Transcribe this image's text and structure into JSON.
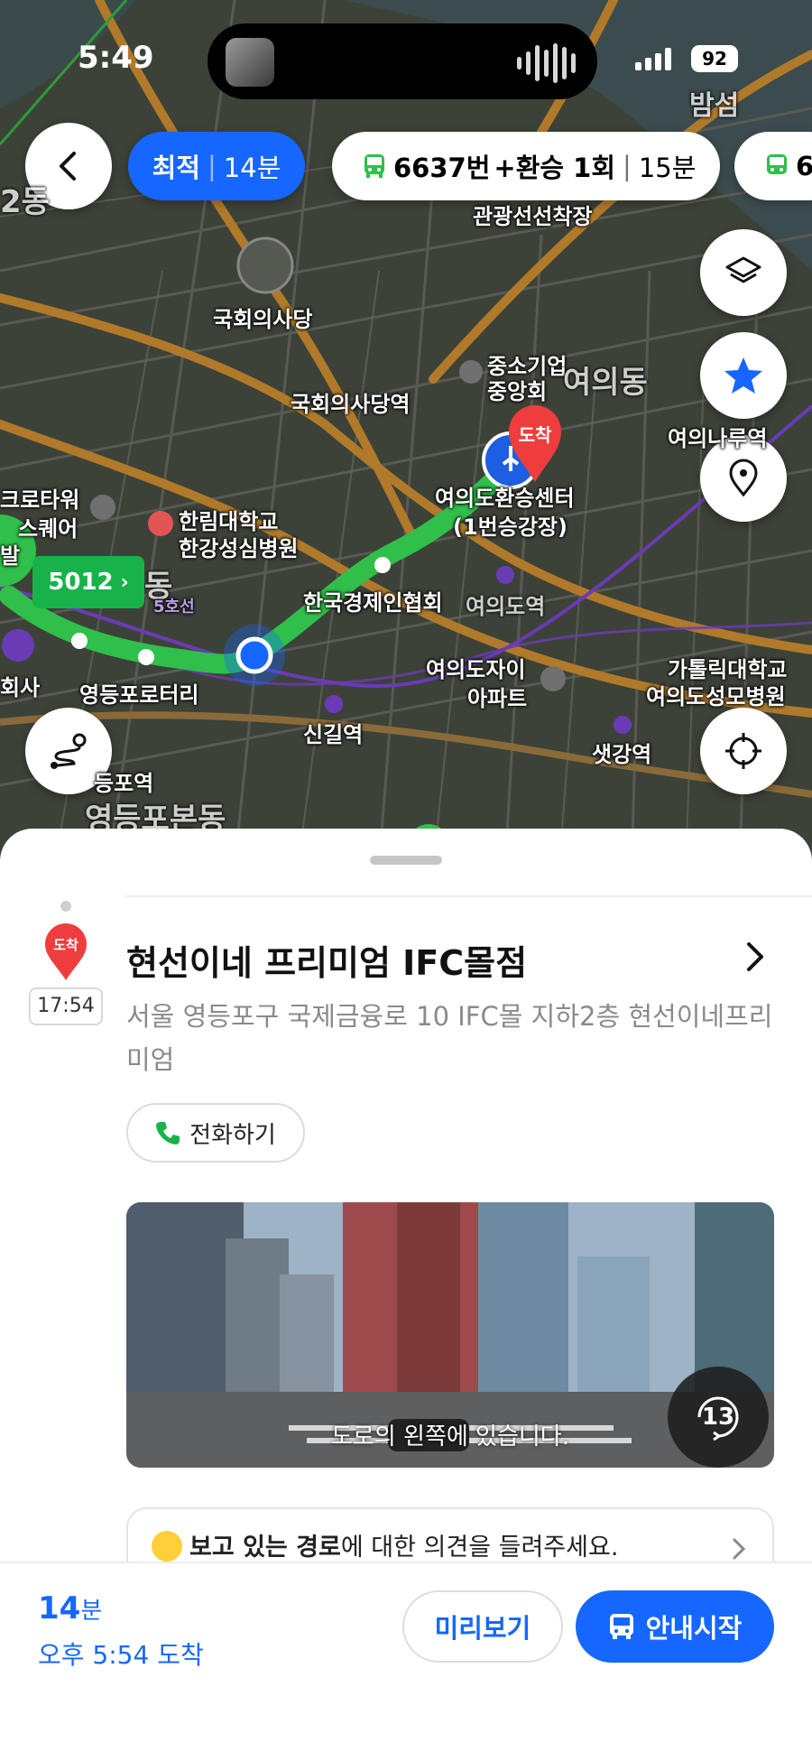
{
  "status_bar": {
    "time": "5:49",
    "battery": "92"
  },
  "route_options": [
    {
      "label": "최적",
      "duration": "14분",
      "selected": true
    },
    {
      "label": "6637번",
      "transfer": "+환승 1회",
      "duration": "15분",
      "selected": false
    },
    {
      "label": "6",
      "selected": false
    }
  ],
  "map": {
    "labels": {
      "gwangong": "관광선선착장",
      "bamseom": "밤섬",
      "assembly": "국회의사당",
      "assembly_station": "국회의사당역",
      "kbiz_1": "중소기업",
      "kbiz_2": "중앙회",
      "yeouido_dong": "여의동",
      "yeouinaru": "여의나루역",
      "transfer_center_1": "여의도환승센터",
      "transfer_center_2": "(1번승강장)",
      "crown_1": "크로타워",
      "crown_2": "스퀘어",
      "hallym_1": "한림대학교",
      "hallym_2": "한강성심병원",
      "fki": "한국경제인협회",
      "yeouido_station": "여의도역",
      "yeouido_xi_1": "여의도자이",
      "yeouido_xi_2": "아파트",
      "catholic_1": "가톨릭대학교",
      "catholic_2": "여의도성모병원",
      "yeongdeungpo_rotary": "영등포로터리",
      "singil": "신길역",
      "saetgang": "샛강역",
      "hoesa": "회사",
      "yeongdeungpo_dong": "영등포본동",
      "yeongdeungpo_st": "등포역",
      "dong_left": "2동",
      "dong_mid": "동",
      "line5": "5호선",
      "depart_tag": "발",
      "arrive_pin": "도착"
    },
    "bus_tag": "5012"
  },
  "destination": {
    "pin_label": "도착",
    "arrive_time": "17:54",
    "name": "현선이네 프리미엄 IFC몰점",
    "address": "서울 영등포구 국제금융로 10 IFC몰 지하2층 현선이네프리미엄",
    "call_label": "전화하기",
    "street_caption": "도로의 왼쪽에 있습니다.",
    "rotate_label": "13"
  },
  "feedback": {
    "bold": "보고 있는 경로",
    "rest": "에 대한 의견을 들려주세요."
  },
  "bottom_bar": {
    "duration_num": "14",
    "duration_unit": "분",
    "eta": "오후 5:54 도착",
    "preview_label": "미리보기",
    "start_label": "안내시작"
  },
  "colors": {
    "accent": "#1567ff",
    "route_green": "#2fbf4a",
    "arrive_red": "#ef3d3d"
  }
}
